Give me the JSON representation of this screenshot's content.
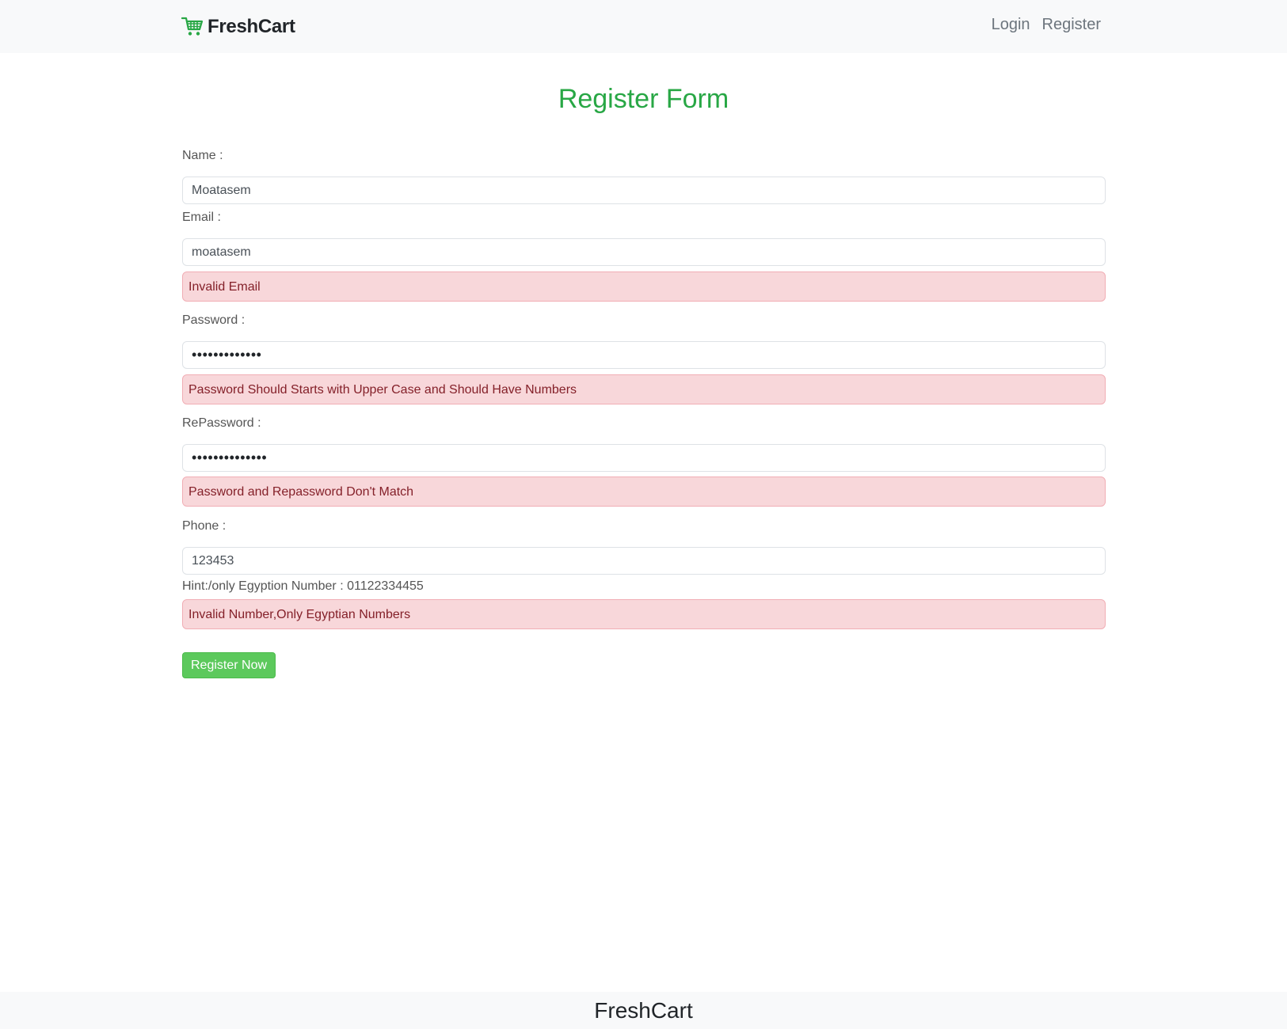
{
  "navbar": {
    "brand_icon": "cart-icon",
    "brand_name": "FreshCart",
    "links": [
      "Login",
      "Register"
    ]
  },
  "form": {
    "title": "Register Form",
    "name_label": "Name :",
    "name_value": "Moatasem",
    "email_label": "Email :",
    "email_value": "moatasem",
    "email_error": "Invalid Email",
    "password_label": "Password :",
    "password_value": "•••••••••••••",
    "password_error": "Password Should Starts with Upper Case and Should Have Numbers",
    "repassword_label": "RePassword :",
    "repassword_value": "••••••••••••••",
    "repassword_error": "Password and Repassword Don't Match",
    "phone_label": "Phone :",
    "phone_value": "123453",
    "phone_hint": "Hint:/only Egyption Number : 01122334455",
    "phone_error": "Invalid Number,Only Egyptian Numbers",
    "submit_label": "Register Now"
  },
  "footer": {
    "text": "FreshCart"
  },
  "colors": {
    "accent": "#28a745",
    "button": "#5cc95c",
    "alert_bg": "#f8d7da",
    "alert_text": "#842029"
  }
}
